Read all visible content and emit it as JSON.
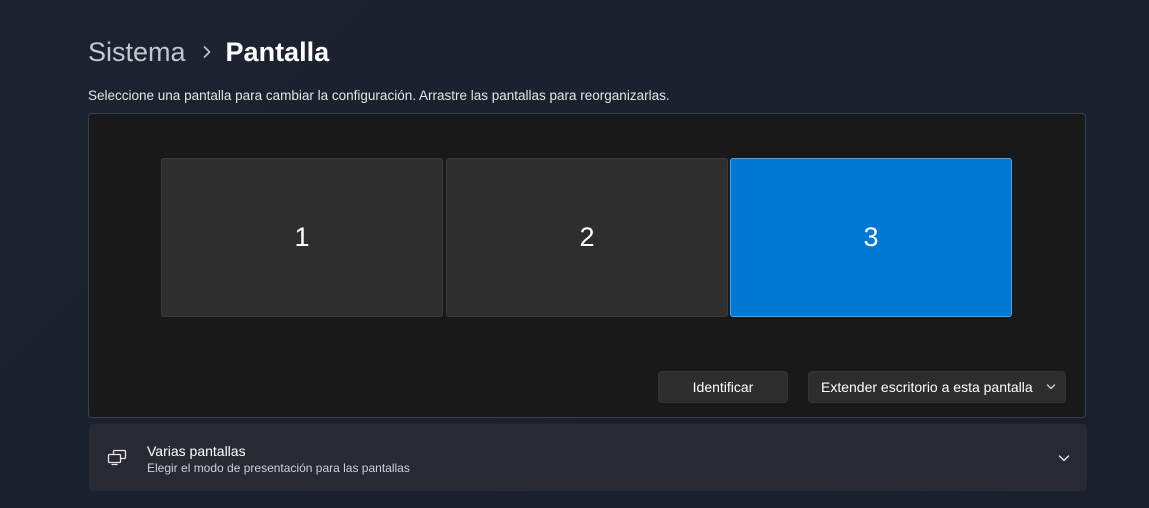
{
  "breadcrumb": {
    "parent": "Sistema",
    "current": "Pantalla"
  },
  "instruction": "Seleccione una pantalla para cambiar la configuración. Arrastre las pantallas para reorganizarlas.",
  "monitors": [
    {
      "label": "1",
      "selected": false
    },
    {
      "label": "2",
      "selected": false
    },
    {
      "label": "3",
      "selected": true
    }
  ],
  "buttons": {
    "identify": "Identificar",
    "extend_mode": "Extender escritorio a esta pantalla"
  },
  "multiple_displays": {
    "title": "Varias pantallas",
    "subtitle": "Elegir el modo de presentación para las pantallas"
  },
  "icons": {
    "breadcrumb_separator": "chevron-right-icon",
    "dropdown": "chevron-down-icon",
    "multiple_displays": "multiple-displays-icon",
    "expand": "chevron-down-icon"
  },
  "colors": {
    "accent_selected": "#0078d4",
    "monitor_unselected": "#2e2e2e",
    "panel_background": "#191919"
  }
}
